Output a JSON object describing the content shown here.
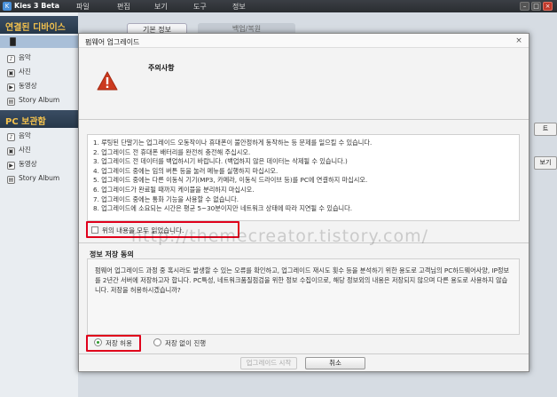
{
  "app": {
    "title": "Kies 3 Beta",
    "menus": [
      "파일",
      "편집",
      "보기",
      "도구",
      "정보"
    ],
    "window_buttons": {
      "minimize": "–",
      "maximize": "□",
      "close": "×"
    }
  },
  "sidebar": {
    "connected_header": "연결된 디바이스",
    "device_items": [
      {
        "label": "음악",
        "icon": "music-icon"
      },
      {
        "label": "사진",
        "icon": "photo-icon"
      },
      {
        "label": "동영상",
        "icon": "video-icon"
      },
      {
        "label": "Story Album",
        "icon": "album-icon"
      }
    ],
    "pc_header": "PC 보관함",
    "pc_items": [
      {
        "label": "음악",
        "icon": "music-icon"
      },
      {
        "label": "사진",
        "icon": "photo-icon"
      },
      {
        "label": "동영상",
        "icon": "video-icon"
      },
      {
        "label": "Story Album",
        "icon": "album-icon"
      }
    ]
  },
  "main": {
    "tabs": [
      "기본 정보",
      "백업/복원"
    ],
    "right_buttons": [
      "트",
      "보기"
    ]
  },
  "dialog": {
    "title": "펌웨어 업그레이드",
    "close": "×",
    "caution_title": "주의사항",
    "notices": [
      "1. 루팅된 단말기는 업그레이드 오동작이나 휴대폰이 불안정하게 동작하는 등 문제를 일으킬 수 있습니다.",
      "2. 업그레이드 전 휴대폰 배터리를 완전히 충전해 주십시오.",
      "3. 업그레이드 전 데이터를 백업하시기 바랍니다. (백업하지 않은 데이터는 삭제될 수 있습니다.)",
      "4. 업그레이드 중에는 임의 버튼 등을 눌러 메뉴를 실행하지 마십시오.",
      "5. 업그레이드 중에는 다른 이동식 기기(MP3, 카메라, 이동식 드라이브 등)를 PC에 연결하지 마십시오.",
      "6. 업그레이드가 완료될 때까지 케이블을 분리하지 마십시오.",
      "7. 업그레이드 중에는 통화 기능을 사용할 수 없습니다.",
      "8. 업그레이드에 소요되는 시간은 평균 5~30분이지만 네트워크 상태에 따라 지연될 수 있습니다."
    ],
    "read_all_label": "위의 내용을 모두 읽었습니다.",
    "consent_title": "정보 저장 동의",
    "consent_text": "펌웨어 업그레이드 과정 중 혹시라도 발생할 수 있는 오류를 확인하고, 업그레이드 재시도 횟수 등을 분석하기 위한 용도로 고객님의 PC하드웨어사양, IP정보를 2년간 서버에 저장하고자 합니다. PC특성, 네트워크품질점검을 위한 정보 수집이므로, 해당 정보외의 내용은 저장되지 않으며 다른 용도로 사용하지 않습니다. 저장을 허용하시겠습니까?",
    "allow_label": "저장 허용",
    "deny_label": "저장 없이 진행",
    "upgrade_button": "업그레이드 시작",
    "cancel_button": "취소"
  },
  "watermark": "http://themecreator.tistory.com/",
  "colors": {
    "highlight": "#e0001b",
    "sidebar_header_text": "#f2c14e",
    "warning": "#cc3a1f"
  }
}
